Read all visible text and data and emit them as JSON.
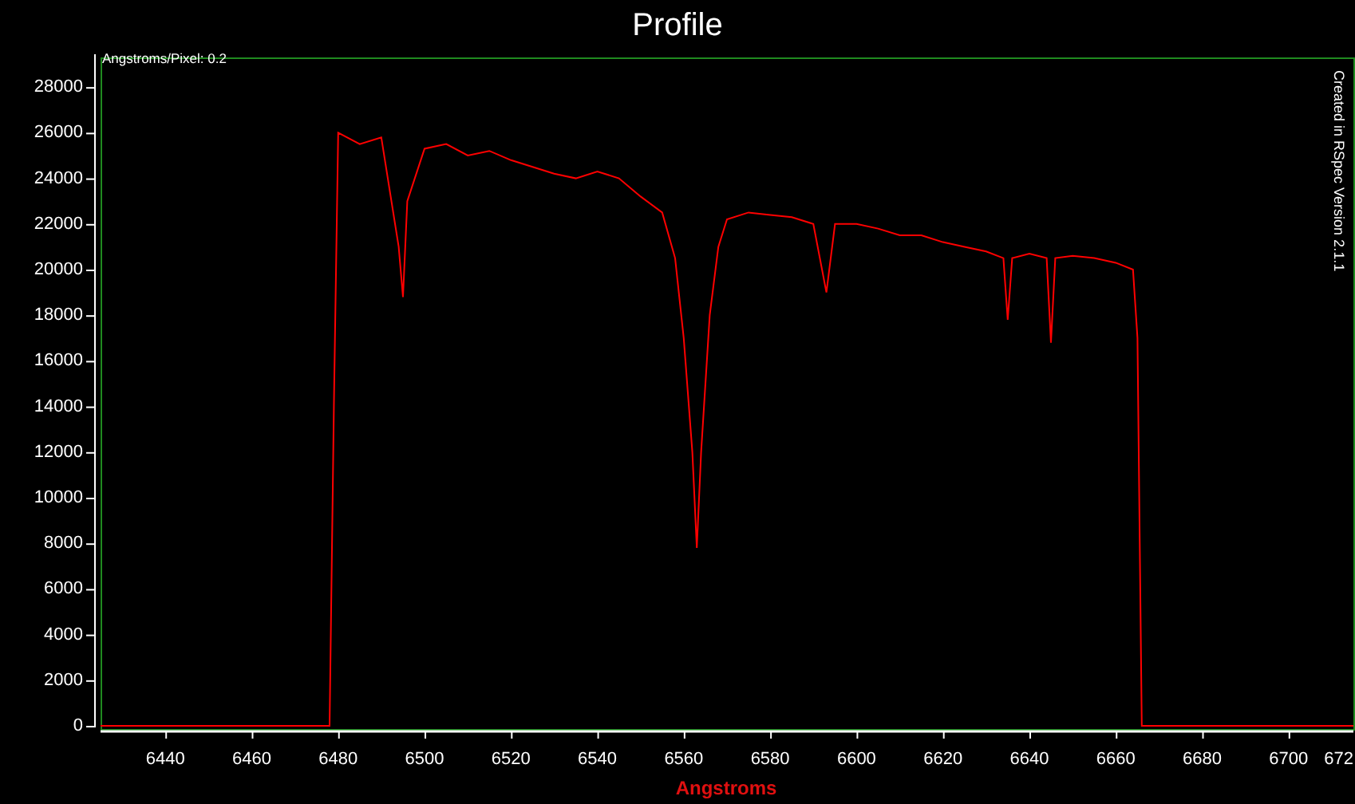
{
  "title": "Profile",
  "dispersion_label": "Angstroms/Pixel: 0.2",
  "credit": "Created in RSpec Version 2.1.1",
  "x_axis_edge_label": "672",
  "chart_data": {
    "type": "line",
    "xlabel": "Angstroms",
    "xlim": [
      6425,
      6715
    ],
    "ylim": [
      0,
      29300
    ],
    "xticks": [
      6440,
      6460,
      6480,
      6500,
      6520,
      6540,
      6560,
      6580,
      6600,
      6620,
      6640,
      6660,
      6680,
      6700
    ],
    "yticks": [
      0,
      2000,
      4000,
      6000,
      8000,
      10000,
      12000,
      14000,
      16000,
      18000,
      20000,
      22000,
      24000,
      26000,
      28000
    ],
    "x": [
      6425,
      6478,
      6479,
      6480,
      6485,
      6490,
      6494,
      6495,
      6496,
      6500,
      6505,
      6510,
      6515,
      6520,
      6525,
      6530,
      6535,
      6540,
      6545,
      6550,
      6555,
      6558,
      6560,
      6562,
      6563,
      6564,
      6566,
      6568,
      6570,
      6575,
      6580,
      6585,
      6590,
      6593,
      6595,
      6600,
      6605,
      6610,
      6615,
      6620,
      6625,
      6630,
      6634,
      6635,
      6636,
      6640,
      6644,
      6645,
      6646,
      6650,
      6655,
      6660,
      6664,
      6665,
      6666,
      6715
    ],
    "series": [
      {
        "color": "#ff0000",
        "values": [
          0,
          0,
          14000,
          26000,
          25500,
          25800,
          21000,
          18800,
          23000,
          25300,
          25500,
          25000,
          25200,
          24800,
          24500,
          24200,
          24000,
          24300,
          24000,
          23200,
          22500,
          20500,
          17000,
          12000,
          7800,
          12000,
          18000,
          21000,
          22200,
          22500,
          22400,
          22300,
          22000,
          19000,
          22000,
          22000,
          21800,
          21500,
          21500,
          21200,
          21000,
          20800,
          20500,
          17800,
          20500,
          20700,
          20500,
          16800,
          20500,
          20600,
          20500,
          20300,
          20000,
          17000,
          0,
          0
        ]
      }
    ]
  }
}
